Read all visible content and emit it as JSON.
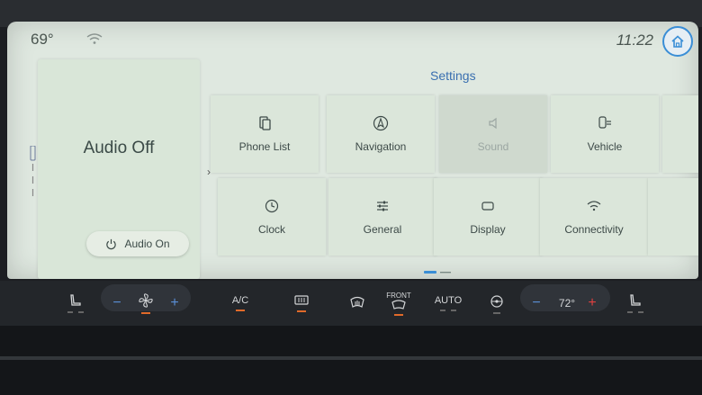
{
  "status": {
    "temperature": "69°",
    "time": "11:22"
  },
  "audio": {
    "title": "Audio Off",
    "button_label": "Audio On"
  },
  "settings": {
    "title": "Settings",
    "tiles": [
      {
        "label": "Phone List",
        "icon": "phone-list-icon",
        "enabled": true
      },
      {
        "label": "Navigation",
        "icon": "navigation-icon",
        "enabled": true
      },
      {
        "label": "Sound",
        "icon": "speaker-icon",
        "enabled": false
      },
      {
        "label": "Vehicle",
        "icon": "vehicle-icon",
        "enabled": true
      },
      {
        "label": "Clock",
        "icon": "clock-icon",
        "enabled": true
      },
      {
        "label": "General",
        "icon": "sliders-icon",
        "enabled": true
      },
      {
        "label": "Display",
        "icon": "display-icon",
        "enabled": true
      },
      {
        "label": "Connectivity",
        "icon": "wifi-icon",
        "enabled": true
      }
    ]
  },
  "climate": {
    "ac_label": "A/C",
    "front_label": "FRONT",
    "auto_label": "AUTO",
    "temp": "72°",
    "minus": "−",
    "plus": "+"
  },
  "colors": {
    "accent": "#3a8ed6",
    "indicator": "#e06a2a",
    "screen_bg": "#dfe8e0"
  }
}
